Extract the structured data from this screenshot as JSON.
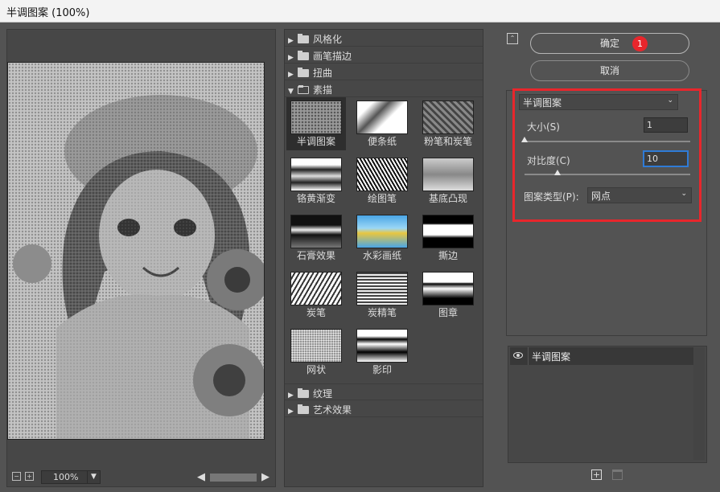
{
  "window": {
    "title": "半调图案 (100%)"
  },
  "preview": {
    "zoom": "100%"
  },
  "gallery": {
    "categories_top": [
      {
        "label": "风格化"
      },
      {
        "label": "画笔描边"
      },
      {
        "label": "扭曲"
      }
    ],
    "open_category": {
      "label": "素描"
    },
    "thumbnails": [
      {
        "label": "半调图案",
        "selected": true
      },
      {
        "label": "便条纸"
      },
      {
        "label": "粉笔和炭笔"
      },
      {
        "label": "铬黄渐变"
      },
      {
        "label": "绘图笔"
      },
      {
        "label": "基底凸现"
      },
      {
        "label": "石膏效果"
      },
      {
        "label": "水彩画纸"
      },
      {
        "label": "撕边"
      },
      {
        "label": "炭笔"
      },
      {
        "label": "炭精笔"
      },
      {
        "label": "图章"
      },
      {
        "label": "网状"
      },
      {
        "label": "影印"
      }
    ],
    "categories_bottom": [
      {
        "label": "纹理"
      },
      {
        "label": "艺术效果"
      }
    ]
  },
  "buttons": {
    "ok": "确定",
    "cancel": "取消",
    "badge": "1"
  },
  "settings": {
    "filter_select": "半调图案",
    "size_label": "大小(S)",
    "size_value": "1",
    "size_level": 0.0,
    "contrast_label": "对比度(C)",
    "contrast_value": "10",
    "contrast_level": 0.2,
    "pattern_type_label": "图案类型(P):",
    "pattern_type_value": "网点"
  },
  "layers": {
    "items": [
      {
        "label": "半调图案"
      }
    ]
  },
  "colors": {
    "highlight": "#e8262c",
    "badge": "#e8262c",
    "focus": "#2f7bd6"
  }
}
